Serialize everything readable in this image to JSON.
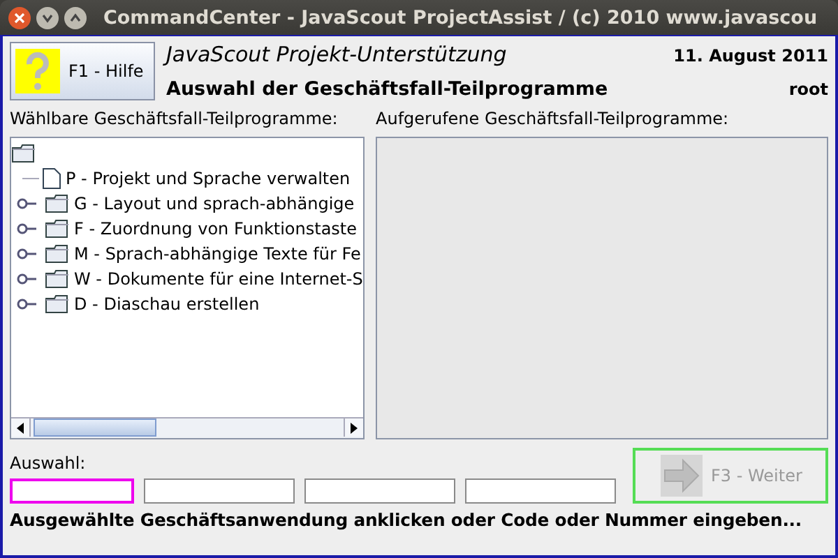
{
  "window": {
    "title": "CommandCenter - JavaScout ProjectAssist / (c) 2010 www.javascou"
  },
  "header": {
    "help_button": "F1 - Hilfe",
    "app_name": "JavaScout Projekt-Unterstützung",
    "heading": "Auswahl der Geschäftsfall-Teilprogramme",
    "date": "11. August 2011",
    "user": "root"
  },
  "available": {
    "label": "Wählbare Geschäftsfall-Teilprogramme:",
    "tree": [
      {
        "kind": "leaf",
        "label": "P - Projekt und Sprache verwalten"
      },
      {
        "kind": "folder",
        "expanded": false,
        "label": "G - Layout und sprach-abhängige"
      },
      {
        "kind": "folder",
        "expanded": false,
        "label": "F - Zuordnung von Funktionstaste"
      },
      {
        "kind": "folder",
        "expanded": false,
        "label": "M - Sprach-abhängige Texte für Fe"
      },
      {
        "kind": "folder",
        "expanded": false,
        "label": "W - Dokumente für eine Internet-S"
      },
      {
        "kind": "folder",
        "expanded": false,
        "label": "D - Diaschau erstellen"
      }
    ]
  },
  "called": {
    "label": "Aufgerufene Geschäftsfall-Teilprogramme:"
  },
  "selection": {
    "label": "Auswahl:",
    "fields": [
      {
        "focused": true
      },
      {
        "focused": false
      },
      {
        "focused": false
      },
      {
        "focused": false
      }
    ]
  },
  "next_button": {
    "label": "F3 - Weiter",
    "disabled": true
  },
  "status_bar": "Ausgewählte Geschäftsanwendung anklicken oder Code oder Nummer eingeben..."
}
